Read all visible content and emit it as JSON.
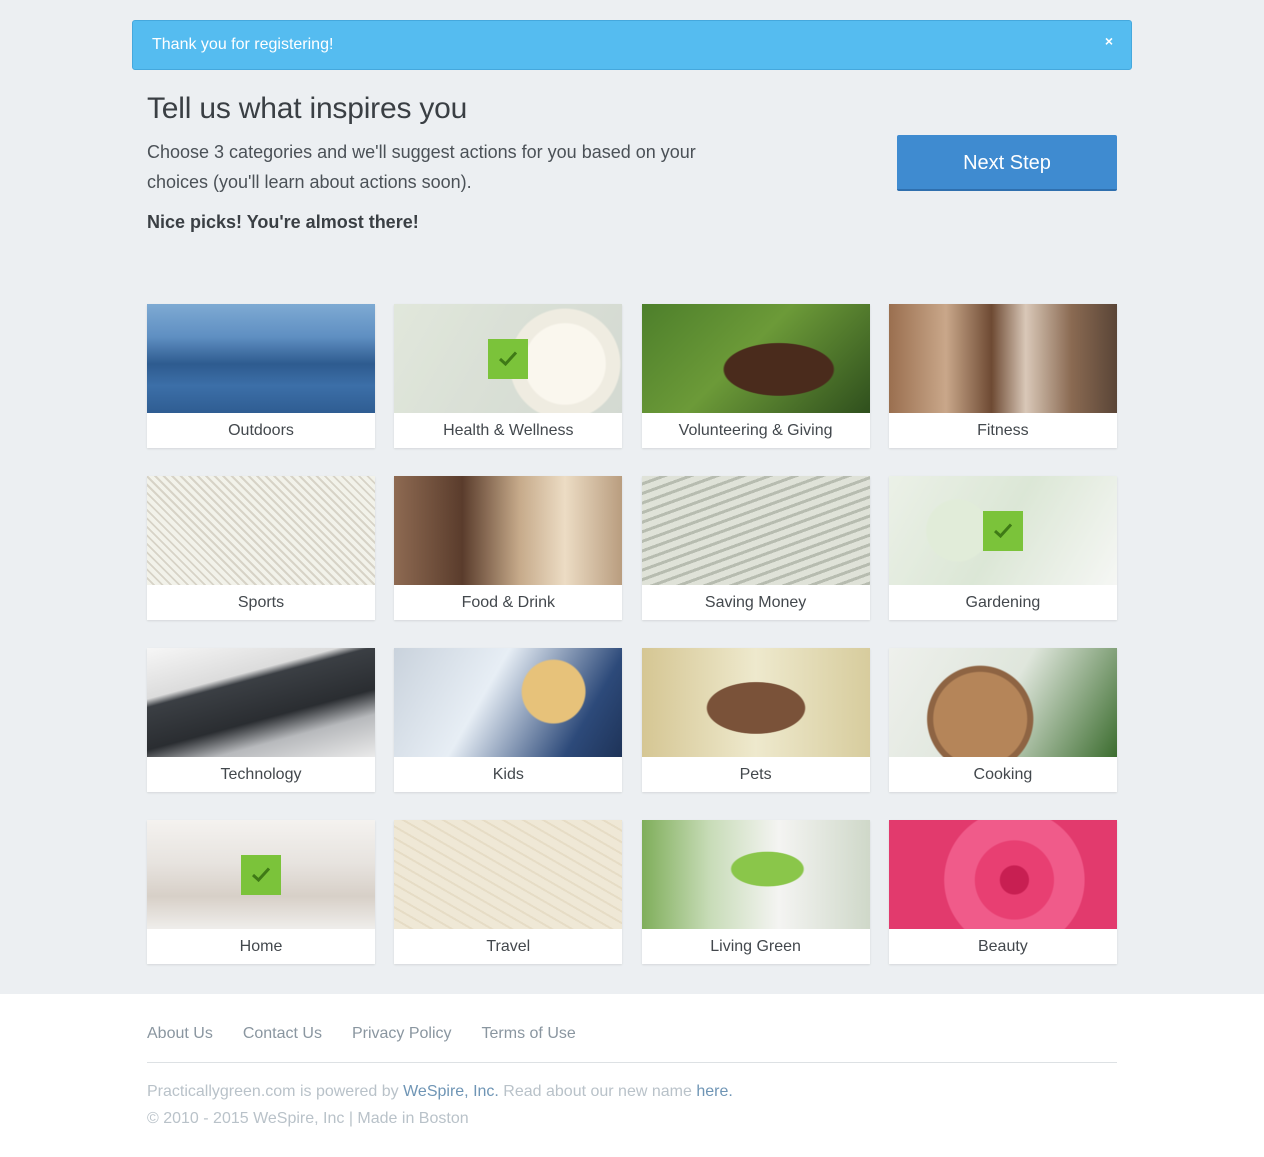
{
  "alert": {
    "message": "Thank you for registering!",
    "close": "×"
  },
  "intro": {
    "title": "Tell us what inspires you",
    "subtitle": "Choose 3 categories and we'll suggest actions for you based on your choices (you'll learn about actions soon).",
    "status": "Nice picks! You're almost there!",
    "next_button": "Next Step"
  },
  "categories": [
    {
      "label": "Outdoors",
      "selected": false
    },
    {
      "label": "Health & Wellness",
      "selected": true
    },
    {
      "label": "Volunteering & Giving",
      "selected": false
    },
    {
      "label": "Fitness",
      "selected": false
    },
    {
      "label": "Sports",
      "selected": false
    },
    {
      "label": "Food & Drink",
      "selected": false
    },
    {
      "label": "Saving Money",
      "selected": false
    },
    {
      "label": "Gardening",
      "selected": true
    },
    {
      "label": "Technology",
      "selected": false
    },
    {
      "label": "Kids",
      "selected": false
    },
    {
      "label": "Pets",
      "selected": false
    },
    {
      "label": "Cooking",
      "selected": false
    },
    {
      "label": "Home",
      "selected": true
    },
    {
      "label": "Travel",
      "selected": false
    },
    {
      "label": "Living Green",
      "selected": false
    },
    {
      "label": "Beauty",
      "selected": false
    }
  ],
  "footer": {
    "links": [
      "About Us",
      "Contact Us",
      "Privacy Policy",
      "Terms of Use"
    ],
    "powered_prefix": "Practicallygreen.com is powered by ",
    "powered_link": "WeSpire, Inc.",
    "powered_middle": " Read about our new name ",
    "powered_here": "here.",
    "copyright": "© 2010 - 2015 WeSpire, Inc | Made in Boston"
  },
  "colors": {
    "alert_bg": "#55bcf0",
    "button_bg": "#3f8bd0",
    "check_bg": "#7bc33a",
    "page_bg": "#eceff2"
  },
  "icons": {
    "check": "checkmark-icon",
    "close": "close-icon"
  }
}
